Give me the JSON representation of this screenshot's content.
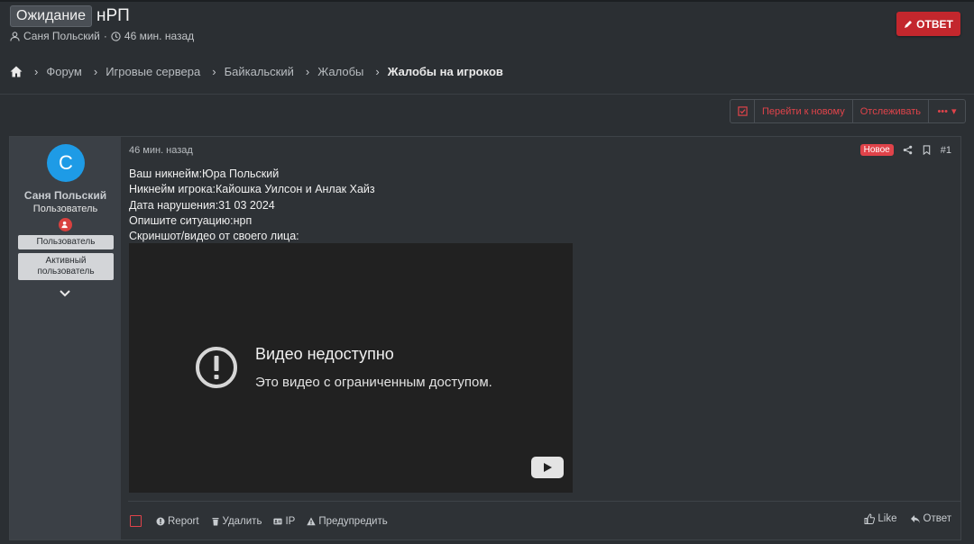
{
  "thread": {
    "prefix": "Ожидание",
    "title": "нРП",
    "author": "Саня Польский",
    "separator": "·",
    "time": "46 мин. назад",
    "reply_label": "ОТВЕТ"
  },
  "breadcrumb": {
    "items": [
      "Форум",
      "Игровые сервера",
      "Байкальский",
      "Жалобы",
      "Жалобы на игроков"
    ]
  },
  "actions": {
    "goto_new": "Перейти к новому",
    "watch": "Отслеживать",
    "more": "•••"
  },
  "user": {
    "avatar_letter": "С",
    "name": "Саня Польский",
    "title": "Пользователь",
    "banners": [
      "Пользователь",
      "Активный пользователь"
    ]
  },
  "post": {
    "date": "46 мин. назад",
    "new_badge": "Новое",
    "number": "#1",
    "lines": [
      "Ваш никнейм:Юра Польский",
      "Никнейм игрока:Кайошка Уилсон и Анлак Хайз",
      "Дата нарушения:31 03 2024",
      "Опишите ситуацию:нрп",
      "Скриншот/видео от своего лица:"
    ],
    "video": {
      "title": "Видео недоступно",
      "subtitle": "Это видео с ограниченным доступом."
    }
  },
  "footer": {
    "report": "Report",
    "delete": "Удалить",
    "ip": "IP",
    "warn": "Предупредить",
    "like": "Like",
    "reply": "Ответ"
  },
  "colors": {
    "accent": "#e0434a",
    "reply_button": "#c3272d",
    "avatar": "#1e9be6",
    "background": "#2b2f33"
  }
}
